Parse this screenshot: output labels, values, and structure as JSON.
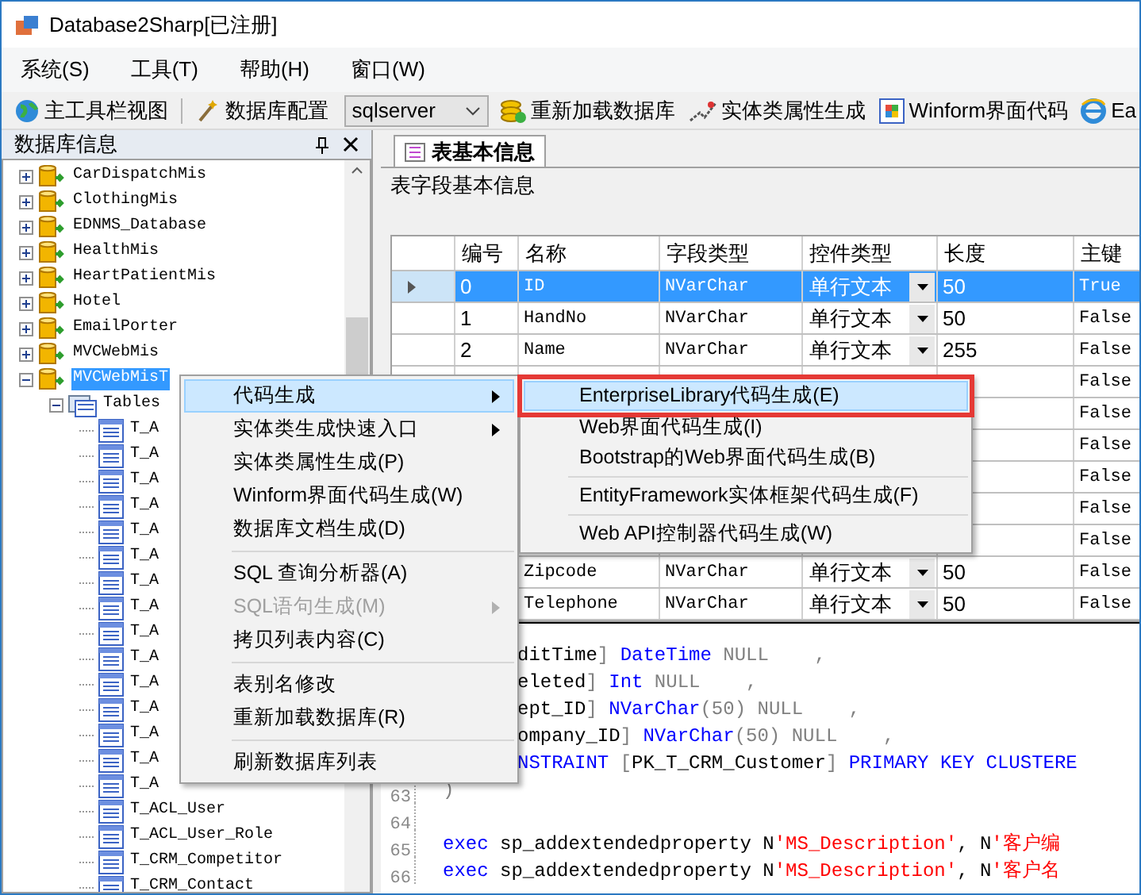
{
  "window": {
    "title": "Database2Sharp[已注册]"
  },
  "menu_bar": [
    "系统(S)",
    "工具(T)",
    "帮助(H)",
    "窗口(W)"
  ],
  "toolbar": [
    {
      "kind": "button",
      "label": "主工具栏视图"
    },
    {
      "kind": "button",
      "label": "数据库配置"
    },
    {
      "kind": "combo",
      "value": "sqlserver"
    },
    {
      "kind": "button",
      "label": "重新加载数据库"
    },
    {
      "kind": "button",
      "label": "实体类属性生成"
    },
    {
      "kind": "button",
      "label": "Winform界面代码"
    },
    {
      "kind": "button",
      "label": "Ea"
    }
  ],
  "database_panel": {
    "title": "数据库信息",
    "tree": [
      {
        "name": "CarDispatchMis",
        "kind": "database",
        "expanded": false,
        "selected": false
      },
      {
        "name": "ClothingMis",
        "kind": "database",
        "expanded": false,
        "selected": false
      },
      {
        "name": "EDNMS_Database",
        "kind": "database",
        "expanded": false,
        "selected": false
      },
      {
        "name": "HealthMis",
        "kind": "database",
        "expanded": false,
        "selected": false
      },
      {
        "name": "HeartPatientMis",
        "kind": "database",
        "expanded": false,
        "selected": false
      },
      {
        "name": "Hotel",
        "kind": "database",
        "expanded": false,
        "selected": false
      },
      {
        "name": "EmailPorter",
        "kind": "database",
        "expanded": false,
        "selected": false
      },
      {
        "name": "MVCWebMis",
        "kind": "database",
        "expanded": false,
        "selected": false
      },
      {
        "name": "MVCWebMisT",
        "kind": "database",
        "expanded": true,
        "selected": true,
        "children": [
          {
            "name": "Tables",
            "kind": "folder",
            "expanded": true,
            "selected": false,
            "children": [
              {
                "name": "T_A",
                "kind": "table",
                "selected": false
              },
              {
                "name": "T_A",
                "kind": "table",
                "selected": false
              },
              {
                "name": "T_A",
                "kind": "table",
                "selected": false
              },
              {
                "name": "T_A",
                "kind": "table",
                "selected": false
              },
              {
                "name": "T_A",
                "kind": "table",
                "selected": false
              },
              {
                "name": "T_A",
                "kind": "table",
                "selected": false
              },
              {
                "name": "T_A",
                "kind": "table",
                "selected": false
              },
              {
                "name": "T_A",
                "kind": "table",
                "selected": false
              },
              {
                "name": "T_A",
                "kind": "table",
                "selected": false
              },
              {
                "name": "T_A",
                "kind": "table",
                "selected": false
              },
              {
                "name": "T_A",
                "kind": "table",
                "selected": false
              },
              {
                "name": "T_A",
                "kind": "table",
                "selected": false
              },
              {
                "name": "T_A",
                "kind": "table",
                "selected": false
              },
              {
                "name": "T_A",
                "kind": "table",
                "selected": false
              },
              {
                "name": "T_A",
                "kind": "table",
                "selected": false
              },
              {
                "name": "T_ACL_User",
                "kind": "table",
                "selected": false
              },
              {
                "name": "T_ACL_User_Role",
                "kind": "table",
                "selected": false
              },
              {
                "name": "T_CRM_Competitor",
                "kind": "table",
                "selected": false
              },
              {
                "name": "T_CRM_Contact",
                "kind": "table",
                "selected": false
              }
            ]
          }
        ]
      }
    ]
  },
  "tabs": [
    {
      "label": "表基本信息",
      "selected": true
    }
  ],
  "section_label": "表字段基本信息",
  "grid": {
    "columns": [
      "编号",
      "名称",
      "字段类型",
      "控件类型",
      "长度",
      "主键"
    ],
    "rows": [
      {
        "selected": true,
        "number": "0",
        "name": "ID",
        "field_type": "NVarChar",
        "control_type": "单行文本",
        "length": "50",
        "primary_key": "True"
      },
      {
        "selected": false,
        "number": "1",
        "name": "HandNo",
        "field_type": "NVarChar",
        "control_type": "单行文本",
        "length": "50",
        "primary_key": "False"
      },
      {
        "selected": false,
        "number": "2",
        "name": "Name",
        "field_type": "NVarChar",
        "control_type": "单行文本",
        "length": "255",
        "primary_key": "False"
      },
      {
        "selected": false,
        "primary_key": "False"
      },
      {
        "selected": false,
        "primary_key": "False"
      },
      {
        "selected": false,
        "primary_key": "False"
      },
      {
        "selected": false,
        "primary_key": "False"
      },
      {
        "selected": false,
        "primary_key": "False"
      },
      {
        "selected": false,
        "primary_key": "False"
      },
      {
        "selected": false,
        "name": "Zipcode",
        "field_type": "NVarChar",
        "control_type": "单行文本",
        "length": "50",
        "primary_key": "False"
      },
      {
        "selected": false,
        "name": "Telephone",
        "field_type": "NVarChar",
        "control_type": "单行文本",
        "length": "50",
        "primary_key": "False"
      }
    ]
  },
  "code": {
    "partial_lines": [
      {
        "tokens": [
          {
            "t": "ditTime",
            "kind": "plain"
          },
          {
            "t": "] ",
            "kind": "gray"
          },
          {
            "t": "DateTime",
            "kind": "keyword"
          },
          {
            "t": " NULL    ,",
            "kind": "gray"
          }
        ]
      },
      {
        "tokens": [
          {
            "t": "eleted",
            "kind": "plain"
          },
          {
            "t": "] ",
            "kind": "gray"
          },
          {
            "t": "Int",
            "kind": "keyword"
          },
          {
            "t": " NULL    ,",
            "kind": "gray"
          }
        ]
      },
      {
        "tokens": [
          {
            "t": "ept_ID",
            "kind": "plain"
          },
          {
            "t": "] ",
            "kind": "gray"
          },
          {
            "t": "NVarChar",
            "kind": "keyword"
          },
          {
            "t": "(50) NULL    ,",
            "kind": "gray"
          }
        ]
      },
      {
        "tokens": [
          {
            "t": "ompany_ID",
            "kind": "plain"
          },
          {
            "t": "] ",
            "kind": "gray"
          },
          {
            "t": "NVarChar",
            "kind": "keyword"
          },
          {
            "t": "(50) NULL    ,",
            "kind": "gray"
          }
        ]
      },
      {
        "tokens": [
          {
            "t": "NSTRAINT",
            "kind": "keyword"
          },
          {
            "t": " [",
            "kind": "gray"
          },
          {
            "t": "PK_T_CRM_Customer",
            "kind": "plain"
          },
          {
            "t": "] ",
            "kind": "gray"
          },
          {
            "t": "PRIMARY KEY CLUSTERE",
            "kind": "keyword"
          }
        ]
      }
    ],
    "lines": [
      {
        "number": "63",
        "tokens": [
          {
            "t": ")",
            "kind": "gray"
          }
        ]
      },
      {
        "number": "64"
      },
      {
        "number": "65",
        "tokens": [
          {
            "t": "exec",
            "kind": "keyword"
          },
          {
            "t": " sp_addextendedproperty N",
            "kind": "plain"
          },
          {
            "t": "'MS_Description'",
            "kind": "string"
          },
          {
            "t": ", N",
            "kind": "plain"
          },
          {
            "t": "'客户编",
            "kind": "string"
          }
        ]
      },
      {
        "number": "66",
        "tokens": [
          {
            "t": "exec",
            "kind": "keyword"
          },
          {
            "t": " sp_addextendedproperty N",
            "kind": "plain"
          },
          {
            "t": "'MS_Description'",
            "kind": "string"
          },
          {
            "t": ", N",
            "kind": "plain"
          },
          {
            "t": "'客户名",
            "kind": "string"
          }
        ]
      }
    ]
  },
  "context_menu": {
    "items": [
      {
        "kind": "item",
        "label": "代码生成",
        "selected": true,
        "disabled": false,
        "submenu": true
      },
      {
        "kind": "item",
        "label": "实体类生成快速入口",
        "selected": false,
        "disabled": false,
        "submenu": true
      },
      {
        "kind": "item",
        "label": "实体类属性生成(P)",
        "selected": false,
        "disabled": false,
        "submenu": false
      },
      {
        "kind": "item",
        "label": "Winform界面代码生成(W)",
        "selected": false,
        "disabled": false,
        "submenu": false
      },
      {
        "kind": "item",
        "label": "数据库文档生成(D)",
        "selected": false,
        "disabled": false,
        "submenu": false
      },
      {
        "kind": "separator"
      },
      {
        "kind": "item",
        "label": "SQL 查询分析器(A)",
        "selected": false,
        "disabled": false,
        "submenu": false
      },
      {
        "kind": "item",
        "label": "SQL语句生成(M)",
        "selected": false,
        "disabled": true,
        "submenu": true
      },
      {
        "kind": "item",
        "label": "拷贝列表内容(C)",
        "selected": false,
        "disabled": false,
        "submenu": false
      },
      {
        "kind": "separator"
      },
      {
        "kind": "item",
        "label": "表别名修改",
        "selected": false,
        "disabled": false,
        "submenu": false
      },
      {
        "kind": "item",
        "label": "重新加载数据库(R)",
        "selected": false,
        "disabled": false,
        "submenu": false
      },
      {
        "kind": "separator"
      },
      {
        "kind": "item",
        "label": "刷新数据库列表",
        "selected": false,
        "disabled": false,
        "submenu": false
      }
    ]
  },
  "submenu": {
    "items": [
      {
        "kind": "item",
        "label": "EnterpriseLibrary代码生成(E)",
        "selected": true,
        "boxed": true
      },
      {
        "kind": "item",
        "label": "Web界面代码生成(I)",
        "selected": false,
        "boxed": false
      },
      {
        "kind": "item",
        "label": "Bootstrap的Web界面代码生成(B)",
        "selected": false,
        "boxed": false
      },
      {
        "kind": "separator"
      },
      {
        "kind": "item",
        "label": "EntityFramework实体框架代码生成(F)",
        "selected": false,
        "boxed": false
      },
      {
        "kind": "separator"
      },
      {
        "kind": "item",
        "label": "Web API控制器代码生成(W)",
        "selected": false,
        "boxed": false
      }
    ]
  }
}
